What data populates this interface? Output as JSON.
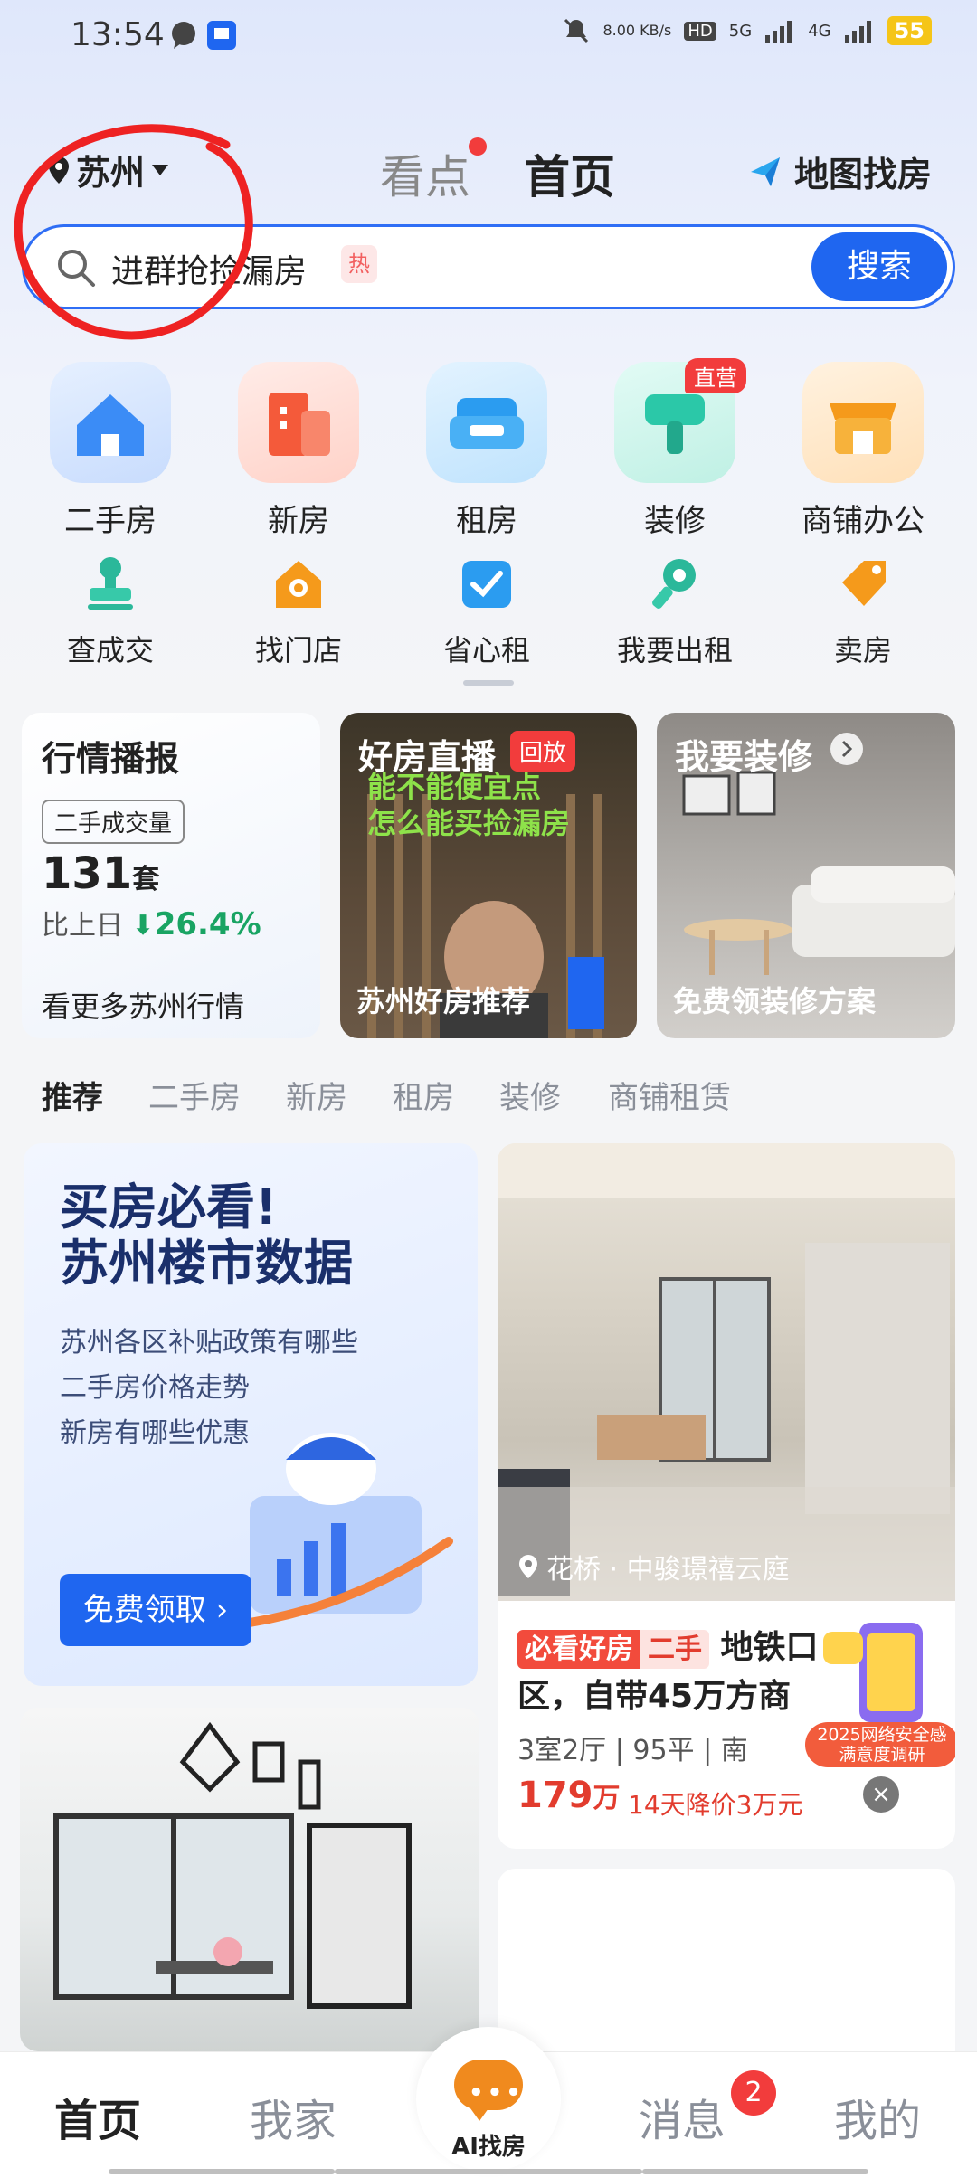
{
  "status_bar": {
    "time": "13:54",
    "net_speed": "8.00 KB/s",
    "hd": "HD",
    "sim1": "1",
    "sim2": "2",
    "sig1": "5G",
    "sig2": "4G",
    "battery": "55"
  },
  "header": {
    "city": "苏州",
    "tab_watch": "看点",
    "tab_home": "首页",
    "map_find": "地图找房"
  },
  "search": {
    "text": "进群抢捡漏房",
    "hot": "热",
    "button": "搜索"
  },
  "grid_primary": [
    {
      "label": "二手房",
      "icon": "house-icon",
      "color": "#3b8cf6"
    },
    {
      "label": "新房",
      "icon": "building-icon",
      "color": "#f45a3a"
    },
    {
      "label": "租房",
      "icon": "sofa-icon",
      "color": "#2b9cf0"
    },
    {
      "label": "装修",
      "icon": "brush-icon",
      "color": "#2bc8a8",
      "badge": "直营"
    },
    {
      "label": "商铺办公",
      "icon": "shop-icon",
      "color": "#f59a1b"
    }
  ],
  "grid_secondary": [
    {
      "label": "查成交",
      "icon": "stamp-icon"
    },
    {
      "label": "找门店",
      "icon": "store-search-icon"
    },
    {
      "label": "省心租",
      "icon": "check-box-icon"
    },
    {
      "label": "我要出租",
      "icon": "key-icon"
    },
    {
      "label": "卖房",
      "icon": "tag-icon"
    }
  ],
  "cards": {
    "market": {
      "title": "行情播报",
      "tag": "二手成交量",
      "count": "131",
      "unit": "套",
      "compare_label": "比上日",
      "compare_value": "26.4%",
      "more": "看更多苏州行情"
    },
    "live": {
      "title": "好房直播",
      "replay": "回放",
      "overlay_line1": "能不能便宜点",
      "overlay_line2": "怎么能买捡漏房",
      "bottom": "苏州好房推荐"
    },
    "decor": {
      "title": "我要装修",
      "bottom": "免费领装修方案"
    }
  },
  "category_tabs": [
    "推荐",
    "二手房",
    "新房",
    "租房",
    "装修",
    "商铺租赁"
  ],
  "promo": {
    "title_line1": "买房必看!",
    "title_line2": "苏州楼市数据",
    "line1": "苏州各区补贴政策有哪些",
    "line2": "二手房价格走势",
    "line3": "新房有哪些优惠",
    "button": "免费领取 ›"
  },
  "listing": {
    "location": "花桥 · 中骏璟禧云庭",
    "tag1": "必看好房",
    "tag2": "二手",
    "title": "地铁口区，自带45万方商",
    "meta": "3室2厅 | 95平 | 南",
    "price": "179",
    "price_unit": "万",
    "drop": "14天降价3万元",
    "close": "×",
    "survey_label_line1": "2025网络安全感",
    "survey_label_line2": "满意度调研"
  },
  "bottom_nav": {
    "home": "首页",
    "myhome": "我家",
    "ai": "AI找房",
    "messages": "消息",
    "messages_badge": "2",
    "mine": "我的"
  }
}
